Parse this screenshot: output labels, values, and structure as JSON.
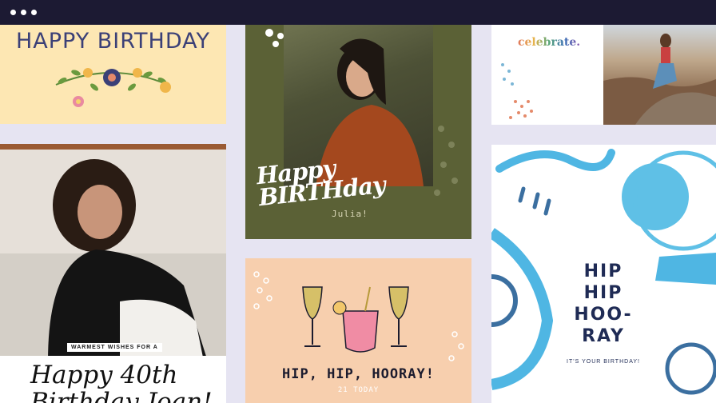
{
  "cards": {
    "yellow": {
      "title": "HAPPY BIRTHDAY"
    },
    "olive": {
      "title_line1": "Happy",
      "title_line2": "BIRTHday",
      "name": "Julia!"
    },
    "celebrate": {
      "title": "celebrate."
    },
    "photo": {
      "tag": "WARMEST WISHES FOR A",
      "script_line1": "Happy 40th",
      "script_line2": "Birthday Joan!"
    },
    "peach": {
      "title": "HIP, HIP, HOORAY!",
      "subtitle": "21 TODAY"
    },
    "blue": {
      "title": "HIP HIP HOO- RAY",
      "subtitle": "IT'S YOUR BIRTHDAY!"
    }
  },
  "colors": {
    "topbar": "#1c1a33",
    "background": "#e6e4f2",
    "navy_text": "#3b4077",
    "olive": "#5b6136",
    "peach": "#f7cfae",
    "blue_brush": "#4fb6e3"
  }
}
